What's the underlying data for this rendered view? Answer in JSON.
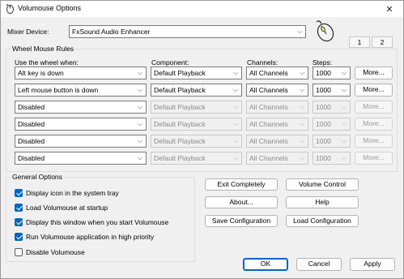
{
  "window": {
    "title": "Volumouse Options",
    "close_glyph": "✕"
  },
  "mixer": {
    "label": "Mixer Device:",
    "value": "FxSound Audio Enhancer"
  },
  "tabs": [
    "1",
    "2"
  ],
  "rules": {
    "title": "Wheel Mouse Rules",
    "headers": {
      "wheel": "Use the wheel when:",
      "component": "Component:",
      "channels": "Channels:",
      "steps": "Steps:"
    },
    "rows": [
      {
        "wheel": "Alt key is down",
        "component": "Default Playback",
        "channels": "All Channels",
        "steps": "1000",
        "more": "More...",
        "enabled": true
      },
      {
        "wheel": "Left mouse button is down",
        "component": "Default Playback",
        "channels": "All Channels",
        "steps": "1000",
        "more": "More...",
        "enabled": true
      },
      {
        "wheel": "Disabled",
        "component": "Default Playback",
        "channels": "All Channels",
        "steps": "1000",
        "more": "More...",
        "enabled": false
      },
      {
        "wheel": "Disabled",
        "component": "Default Playback",
        "channels": "All Channels",
        "steps": "1000",
        "more": "More...",
        "enabled": false
      },
      {
        "wheel": "Disabled",
        "component": "Default Playback",
        "channels": "All Channels",
        "steps": "1000",
        "more": "More...",
        "enabled": false
      },
      {
        "wheel": "Disabled",
        "component": "Default Playback",
        "channels": "All Channels",
        "steps": "1000",
        "more": "More...",
        "enabled": false
      }
    ]
  },
  "general": {
    "title": "General Options",
    "options": [
      {
        "label": "Display icon in the system tray",
        "checked": true
      },
      {
        "label": "Load Volumouse at startup",
        "checked": true
      },
      {
        "label": "Display this window when you start Volumouse",
        "checked": true
      },
      {
        "label": "Run Volumouse application in high priority",
        "checked": true
      },
      {
        "label": "Disable Volumouse",
        "checked": false
      }
    ]
  },
  "actions": {
    "exit": "Exit Completely",
    "volume_control": "Volume Control",
    "about": "About...",
    "help": "Help",
    "save_config": "Save Configuration",
    "load_config": "Load Configuration"
  },
  "footer": {
    "ok": "OK",
    "cancel": "Cancel",
    "apply": "Apply"
  },
  "colors": {
    "accent": "#0067c0",
    "dialog_bg": "#f0f0f0"
  }
}
